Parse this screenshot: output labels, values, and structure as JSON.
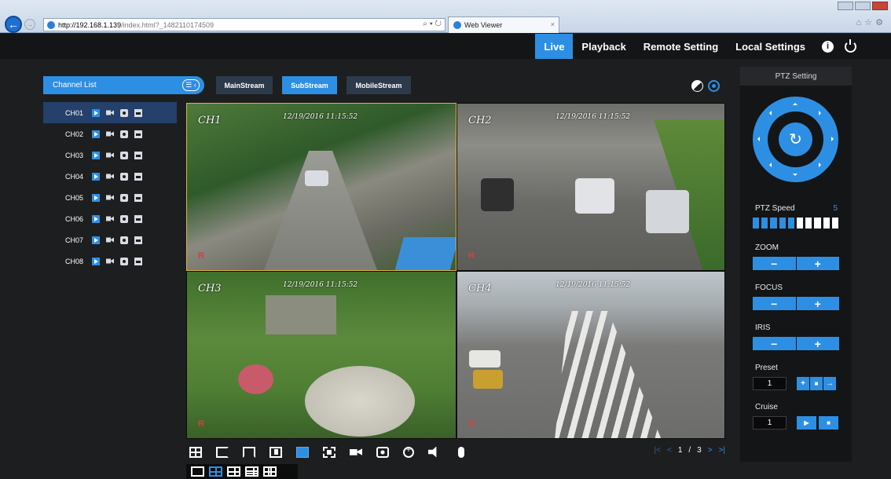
{
  "browser": {
    "url_host": "http://192.168.1.139",
    "url_path": "/index.html?_1482110174509",
    "tab_title": "Web Viewer",
    "tab_close": "×",
    "addr_tools": "⌕ ▾ ↻"
  },
  "nav": {
    "items": [
      {
        "label": "Live",
        "active": true
      },
      {
        "label": "Playback",
        "active": false
      },
      {
        "label": "Remote Setting",
        "active": false
      },
      {
        "label": "Local Settings",
        "active": false
      }
    ],
    "info_icon": "i"
  },
  "channel_list": {
    "title": "Channel List",
    "toggle_icon": "☰ ‹",
    "channels": [
      "CH01",
      "CH02",
      "CH03",
      "CH04",
      "CH05",
      "CH06",
      "CH07",
      "CH08"
    ],
    "selected": "CH01"
  },
  "streams": [
    "MainStream",
    "SubStream",
    "MobileStream"
  ],
  "active_stream": "SubStream",
  "tiles": [
    {
      "label": "CH1",
      "time": "12/19/2016 11:15:52"
    },
    {
      "label": "CH2",
      "time": "12/19/2016 11:15:52"
    },
    {
      "label": "CH3",
      "time": "12/19/2016 11:15:52"
    },
    {
      "label": "CH4",
      "time": "12/19/2016 11:15:52"
    }
  ],
  "rec_mark": "R",
  "pager": {
    "first": "|<",
    "prev": "<",
    "current": "1",
    "sep": "/",
    "total": "3",
    "next": ">",
    "last": ">|"
  },
  "ptz": {
    "title": "PTZ Setting",
    "center_icon": "↻",
    "speed_label": "PTZ Speed",
    "speed_value": "5",
    "speed_level": 5,
    "speed_max": 10,
    "zoom_label": "ZOOM",
    "focus_label": "FOCUS",
    "iris_label": "IRIS",
    "minus": "−",
    "plus": "+",
    "preset_label": "Preset",
    "preset_value": "1",
    "preset_add": "+",
    "preset_delete": "■",
    "preset_go": "→",
    "cruise_label": "Cruise",
    "cruise_value": "1",
    "cruise_play": "▶",
    "cruise_stop": "■"
  }
}
